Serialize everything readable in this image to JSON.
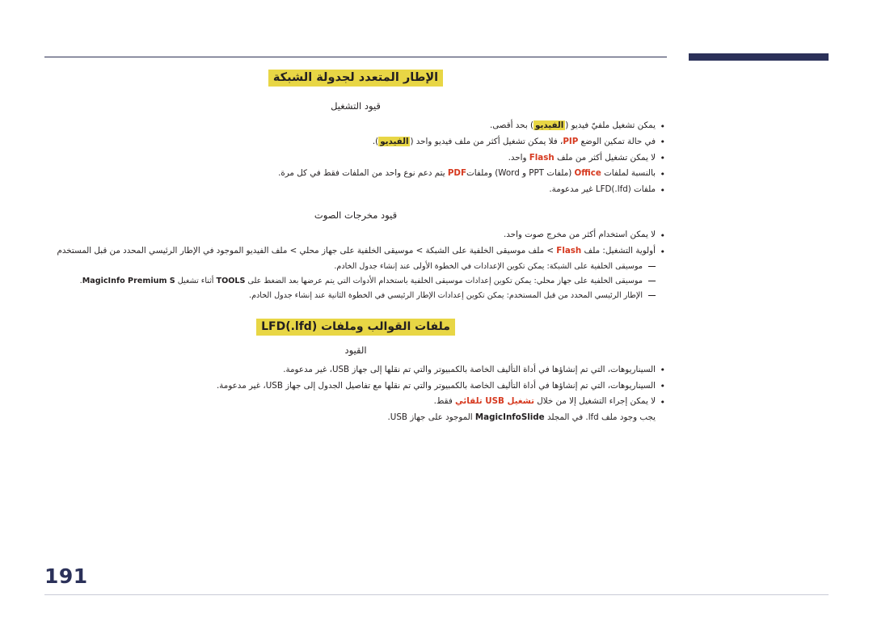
{
  "document": {
    "page_number": "191",
    "title": "الإطار المتعدد لجدولة الشبكة",
    "subsection_title": "ملفات القوالب وملفات (LFD(.lfd"
  },
  "sections": [
    {
      "heading": "قيود التشغيل",
      "bullets": [
        {
          "parts": [
            {
              "text": "يمكن تشغيل ملفيّ فيديو (",
              "style": "plain"
            },
            {
              "text": "الفيديو",
              "style": "highlight"
            },
            {
              "text": ") بحد أقصى.",
              "style": "plain"
            }
          ]
        },
        {
          "parts": [
            {
              "text": "في حالة تمكين الوضع ",
              "style": "plain"
            },
            {
              "text": "PIP",
              "style": "red"
            },
            {
              "text": "، فلا يمكن تشغيل أكثر من ملف فيديو واحد (",
              "style": "plain"
            },
            {
              "text": "الفيديو",
              "style": "highlight"
            },
            {
              "text": ").",
              "style": "plain"
            }
          ]
        },
        {
          "parts": [
            {
              "text": "لا يمكن تشغيل أكثر من ملف ",
              "style": "plain"
            },
            {
              "text": "Flash",
              "style": "red"
            },
            {
              "text": " واحد.",
              "style": "plain"
            }
          ]
        },
        {
          "parts": [
            {
              "text": "بالنسبة لملفات ",
              "style": "plain"
            },
            {
              "text": "Office",
              "style": "red"
            },
            {
              "text": " (ملفات PPT و Word) وملفات",
              "style": "plain"
            },
            {
              "text": "PDF",
              "style": "red"
            },
            {
              "text": " يتم دعم نوع واحد من الملفات فقط في كل مرة.",
              "style": "plain"
            }
          ]
        },
        {
          "parts": [
            {
              "text": "ملفات (LFD(.lfd غير مدعومة.",
              "style": "plain"
            }
          ]
        }
      ]
    },
    {
      "heading": "قيود مخرجات الصوت",
      "bullets": [
        {
          "parts": [
            {
              "text": "لا يمكن استخدام أكثر من مخرج صوت واحد.",
              "style": "plain"
            }
          ]
        },
        {
          "parts": [
            {
              "text": "أولوية التشغيل: ملف ",
              "style": "plain"
            },
            {
              "text": "Flash",
              "style": "red"
            },
            {
              "text": " > ملف موسيقى الخلفية على الشبكة > موسيقى الخلفية على جهاز محلي > ملف الفيديو الموجود في الإطار الرئيسي المحدد من قبل المستخدم",
              "style": "plain"
            }
          ]
        }
      ],
      "notes": [
        {
          "parts": [
            {
              "text": "موسيقى الخلفية على الشبكة: يمكن تكوين الإعدادات في الخطوة الأولى عند إنشاء جدول الخادم.",
              "style": "plain"
            }
          ]
        },
        {
          "parts": [
            {
              "text": "موسيقى الخلفية على جهاز محلي: يمكن تكوين إعدادات موسيقى الخلفية باستخدام الأدوات التي يتم عرضها بعد الضغط على ",
              "style": "plain"
            },
            {
              "text": "TOOLS",
              "style": "bold"
            },
            {
              "text": " أثناء تشغيل ",
              "style": "plain"
            },
            {
              "text": "MagicInfo Premium S",
              "style": "bold"
            },
            {
              "text": ".",
              "style": "plain"
            }
          ]
        },
        {
          "parts": [
            {
              "text": "الإطار الرئيسي المحدد من قبل المستخدم: يمكن تكوين إعدادات الإطار الرئيسي في الخطوة الثانية عند إنشاء جدول الخادم.",
              "style": "plain"
            }
          ]
        }
      ]
    },
    {
      "heading": "القيود",
      "bullets": [
        {
          "parts": [
            {
              "text": "السيناريوهات، التي تم إنشاؤها في أداة التأليف الخاصة بالكمبيوتر والتي تم نقلها إلى جهاز USB، غير مدعومة.",
              "style": "plain"
            }
          ]
        },
        {
          "parts": [
            {
              "text": "السيناريوهات، التي تم إنشاؤها في أداة التأليف الخاصة بالكمبيوتر والتي تم نقلها مع تفاصيل الجدول إلى جهاز USB، غير مدعومة.",
              "style": "plain"
            }
          ]
        },
        {
          "parts": [
            {
              "text": "لا يمكن إجراء التشغيل إلا من خلال ",
              "style": "plain"
            },
            {
              "text": "تشغيل USB تلقائي",
              "style": "red"
            },
            {
              "text": " فقط.",
              "style": "plain"
            }
          ]
        }
      ],
      "trailing": {
        "parts": [
          {
            "text": "يجب وجود ملف lfd. في المجلد ",
            "style": "plain"
          },
          {
            "text": "MagicInfoSlide",
            "style": "bold"
          },
          {
            "text": " الموجود على جهاز USB.",
            "style": "plain"
          }
        ]
      }
    }
  ],
  "colors": {
    "accent_navy": "#2b3159",
    "highlight_yellow": "#e8d645",
    "red": "#d6391f",
    "text": "#231f20"
  }
}
